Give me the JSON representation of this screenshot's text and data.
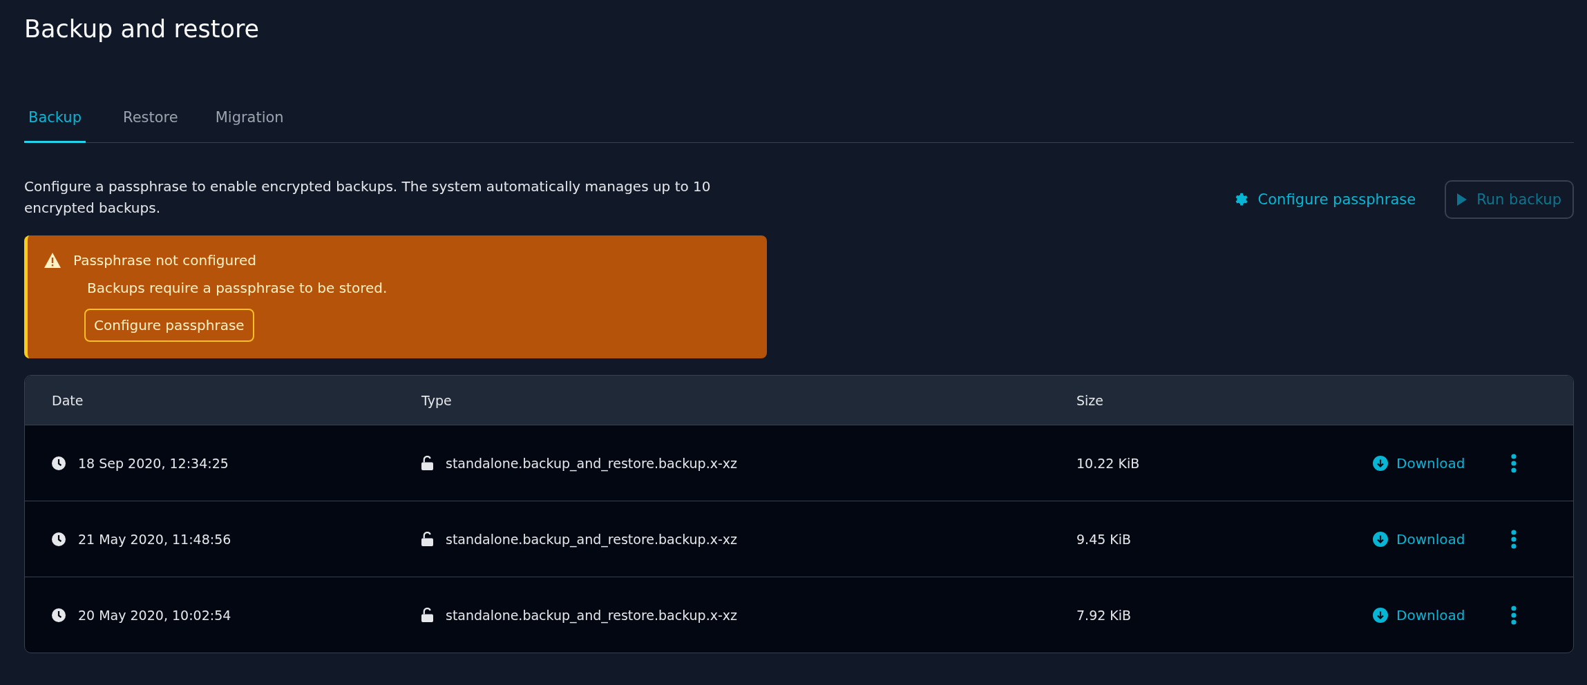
{
  "page": {
    "title": "Backup and restore"
  },
  "tabs": [
    {
      "label": "Backup",
      "selected": true
    },
    {
      "label": "Restore",
      "selected": false
    },
    {
      "label": "Migration",
      "selected": false
    }
  ],
  "description": "Configure a passphrase to enable encrypted backups. The system automatically manages up to 10 encrypted backups.",
  "actions": {
    "configure_link": "Configure passphrase",
    "run_backup": {
      "label": "Run backup",
      "disabled": true
    }
  },
  "alert": {
    "title": "Passphrase not configured",
    "message": "Backups require a passphrase to be stored.",
    "button": "Configure passphrase"
  },
  "table": {
    "columns": [
      "Date",
      "Type",
      "Size"
    ],
    "rows": [
      {
        "date": "18 Sep 2020, 12:34:25",
        "type": "standalone.backup_and_restore.backup.x-xz",
        "encrypted": false,
        "size": "10.22 KiB",
        "action": "Download"
      },
      {
        "date": "21 May 2020, 11:48:56",
        "type": "standalone.backup_and_restore.backup.x-xz",
        "encrypted": false,
        "size": "9.45 KiB",
        "action": "Download"
      },
      {
        "date": "20 May 2020, 10:02:54",
        "type": "standalone.backup_and_restore.backup.x-xz",
        "encrypted": false,
        "size": "7.92 KiB",
        "action": "Download"
      }
    ]
  }
}
